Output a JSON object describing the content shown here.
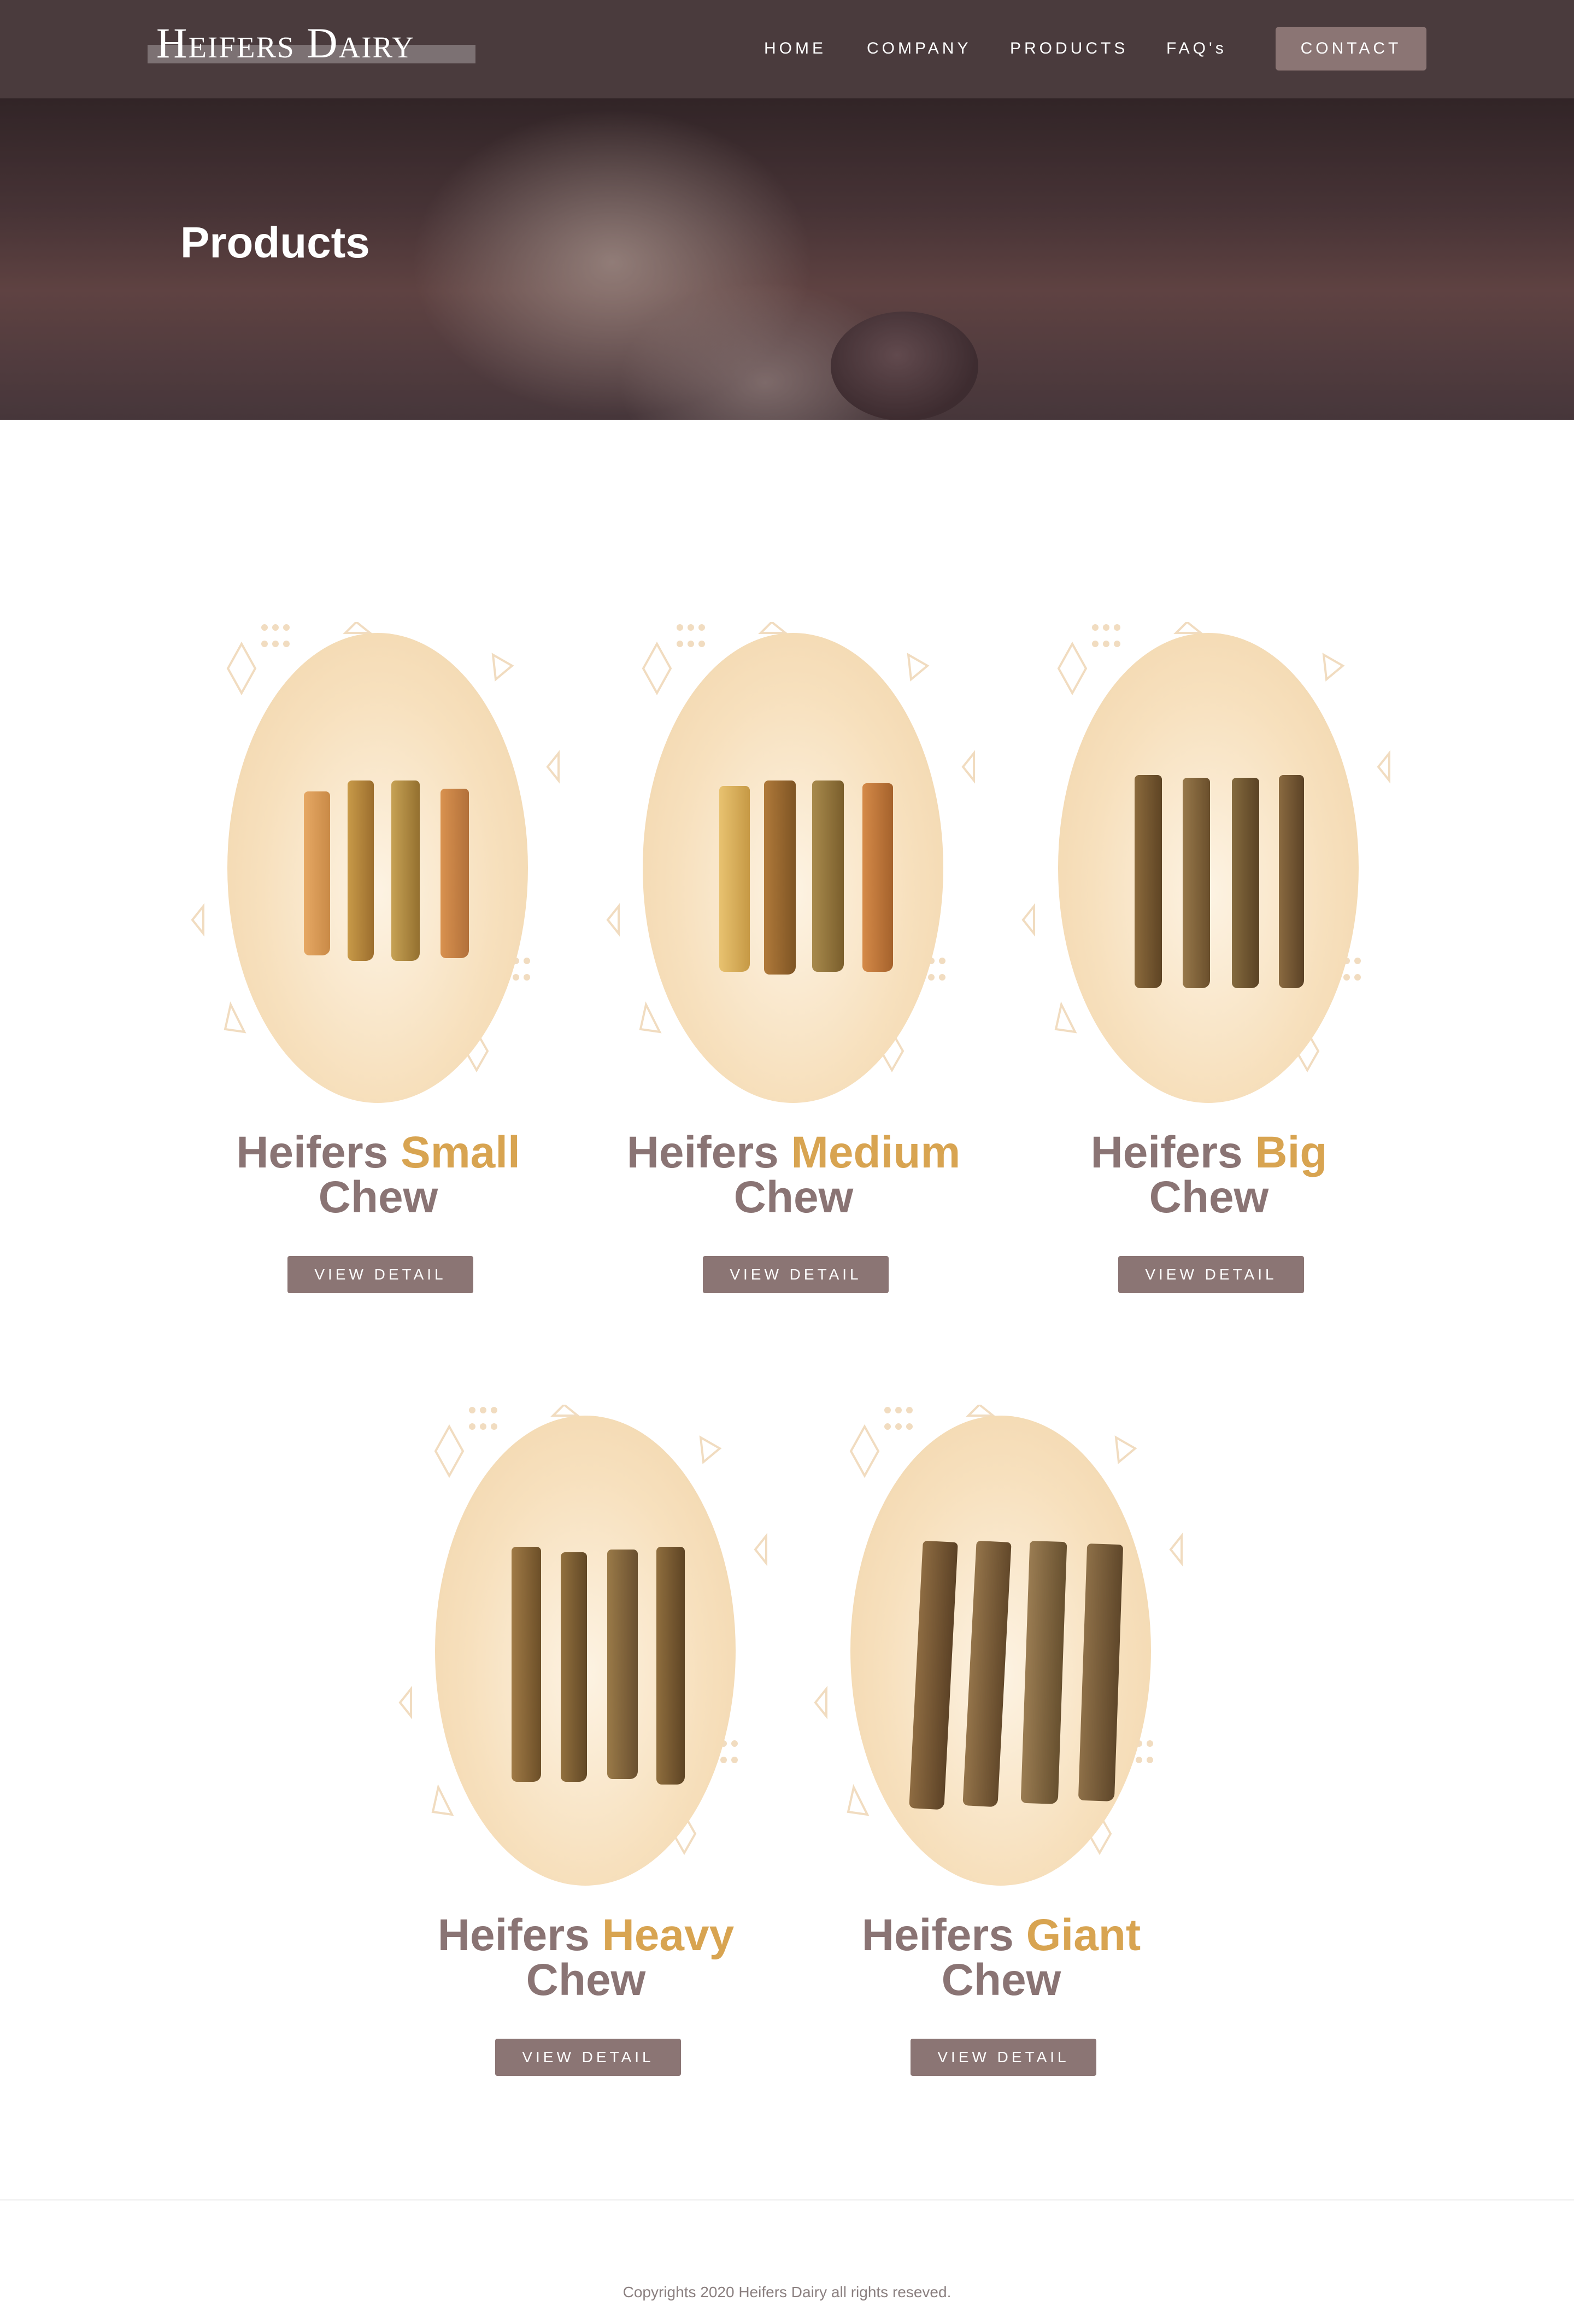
{
  "header": {
    "logo": "Heifers Dairy",
    "nav": [
      "HOME",
      "COMPANY",
      "PRODUCTS",
      "FAQ's"
    ],
    "contact_label": "CONTACT"
  },
  "hero": {
    "title": "Products"
  },
  "products": [
    {
      "name_prefix": "Heifers",
      "name_accent": "Small",
      "name_suffix": "Chew",
      "button": "VIEW DETAIL"
    },
    {
      "name_prefix": "Heifers",
      "name_accent": "Medium",
      "name_suffix": "Chew",
      "button": "VIEW DETAIL"
    },
    {
      "name_prefix": "Heifers",
      "name_accent": "Big",
      "name_suffix": "Chew",
      "button": "VIEW DETAIL"
    },
    {
      "name_prefix": "Heifers",
      "name_accent": "Heavy",
      "name_suffix": "Chew",
      "button": "VIEW DETAIL"
    },
    {
      "name_prefix": "Heifers",
      "name_accent": "Giant",
      "name_suffix": "Chew",
      "button": "VIEW DETAIL"
    }
  ],
  "footer": {
    "copyright": "Copyrights 2020 Heifers Dairy all rights reseved."
  },
  "colors": {
    "header_bg": "#4a3b3d",
    "button_bg": "#8b7574",
    "title_gray": "#8a7474",
    "accent_gold": "#d8a451"
  }
}
